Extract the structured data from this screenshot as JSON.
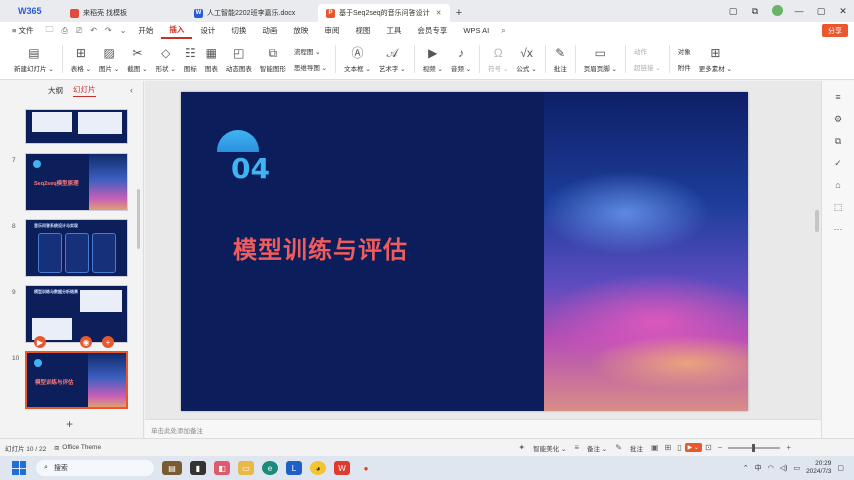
{
  "titlebar": {
    "logo": "W365",
    "tabs": [
      {
        "label": "来稻壳 找模板",
        "badge": "",
        "badge_color": "#e14b3c",
        "active": false
      },
      {
        "label": "人工智能2202班李嘉乐.docx",
        "badge": "W",
        "badge_color": "#2a5bd7",
        "active": false
      },
      {
        "label": "基于Seq2seq的音乐问答设计",
        "badge": "P",
        "badge_color": "#e8572e",
        "active": true
      }
    ],
    "window_controls": [
      "▢",
      "⧉",
      "—",
      "▢",
      "✕"
    ]
  },
  "menubar": {
    "file_label": "≡ 文件",
    "quick_access": [
      "🗀",
      "⎙",
      "🖨",
      "↶",
      "↷",
      "⌄"
    ],
    "items": [
      "开始",
      "插入",
      "设计",
      "切换",
      "动画",
      "放映",
      "审阅",
      "视图",
      "工具",
      "会员专享",
      "WPS AI"
    ],
    "active_item": "插入",
    "share_label": "分享"
  },
  "ribbon": {
    "groups": [
      {
        "icon": "▤",
        "label": "新建幻灯片 ⌄",
        "disabled": false
      },
      {
        "icon": "⊞",
        "label": "表格 ⌄",
        "disabled": false
      },
      {
        "icon": "🖼",
        "label": "图片 ⌄",
        "disabled": false
      },
      {
        "icon": "✂",
        "label": "截图 ⌄",
        "disabled": false
      },
      {
        "icon": "◇",
        "label": "形状 ⌄",
        "disabled": false
      },
      {
        "icon": "☷",
        "label": "图标",
        "disabled": false
      },
      {
        "icon": "▦",
        "label": "图表",
        "disabled": false
      },
      {
        "icon": "◰",
        "label": "动态图表",
        "disabled": false
      },
      {
        "icon": "⧉",
        "label": "智能图形",
        "disabled": false
      }
    ],
    "stack1": [
      "流程图 ⌄",
      "思维导图 ⌄"
    ],
    "groups2": [
      {
        "icon": "A",
        "label": "文本框 ⌄",
        "disabled": false
      },
      {
        "icon": "A",
        "label": "艺术字 ⌄",
        "disabled": false
      },
      {
        "icon": "▶",
        "label": "视频 ⌄",
        "disabled": false
      },
      {
        "icon": "♪",
        "label": "音频 ⌄",
        "disabled": false
      },
      {
        "icon": "Ω",
        "label": "符号 ⌄",
        "disabled": true
      },
      {
        "icon": "√x",
        "label": "公式 ⌄",
        "disabled": false
      },
      {
        "icon": "✎",
        "label": "批注",
        "disabled": false
      },
      {
        "icon": "▭",
        "label": "页眉页脚 ⌄",
        "disabled": false
      }
    ],
    "stack2": [
      "动作",
      "超链接 ⌄"
    ],
    "stack3": [
      "对象",
      "附件"
    ],
    "more_label": "更多素材 ⌄",
    "more_icon": "⊞"
  },
  "left_panel": {
    "tabs": [
      "大纲",
      "幻灯片"
    ],
    "active_tab": "幻灯片",
    "collapse_icon": "‹",
    "slides": [
      {
        "num": "",
        "title": ""
      },
      {
        "num": "7",
        "title": "Seq2seq模型原理"
      },
      {
        "num": "8",
        "title": "音乐问答系统设计与实现"
      },
      {
        "num": "9",
        "title": "模型训练与数据分析结果"
      },
      {
        "num": "10",
        "title": "模型训练与评估"
      }
    ],
    "add_icon": "+"
  },
  "slide": {
    "number": "04",
    "title": "模型训练与评估"
  },
  "notes_placeholder": "单击此处添加备注",
  "right_rail_icons": [
    "≡",
    "⚙",
    "⧉",
    "✓",
    "⌂",
    "⬚",
    "···"
  ],
  "statusbar": {
    "slide_counter": "幻灯片 10 / 22",
    "theme": "Office Theme",
    "beautify": "智能美化 ⌄",
    "notes": "备注 ⌄",
    "comments": "批注",
    "zoom": "−  +"
  },
  "taskbar": {
    "search_placeholder": "搜索",
    "time": "20:29",
    "date": "2024/7/3",
    "lang": "中"
  }
}
